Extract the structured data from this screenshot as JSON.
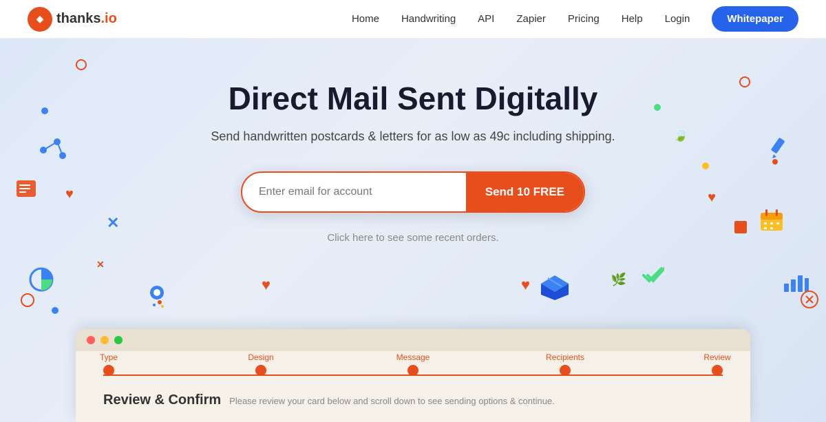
{
  "nav": {
    "logo_text": "thanks",
    "logo_suffix": ".io",
    "links": [
      {
        "label": "Home",
        "id": "home"
      },
      {
        "label": "Handwriting",
        "id": "handwriting"
      },
      {
        "label": "API",
        "id": "api"
      },
      {
        "label": "Zapier",
        "id": "zapier"
      },
      {
        "label": "Pricing",
        "id": "pricing"
      },
      {
        "label": "Help",
        "id": "help"
      },
      {
        "label": "Login",
        "id": "login"
      }
    ],
    "cta_button": "Whitepaper"
  },
  "hero": {
    "title": "Direct Mail Sent Digitally",
    "subtitle": "Send handwritten postcards & letters for as low as 49c including shipping.",
    "email_placeholder": "Enter email for account",
    "cta_button": "Send 10 FREE",
    "recent_link": "Click here to see some recent orders."
  },
  "preview": {
    "steps": [
      {
        "label": "Type"
      },
      {
        "label": "Design"
      },
      {
        "label": "Message"
      },
      {
        "label": "Recipients"
      },
      {
        "label": "Review"
      }
    ],
    "review_title": "Review & Confirm",
    "review_desc": "Please review your card below and scroll down to see sending options & continue."
  }
}
